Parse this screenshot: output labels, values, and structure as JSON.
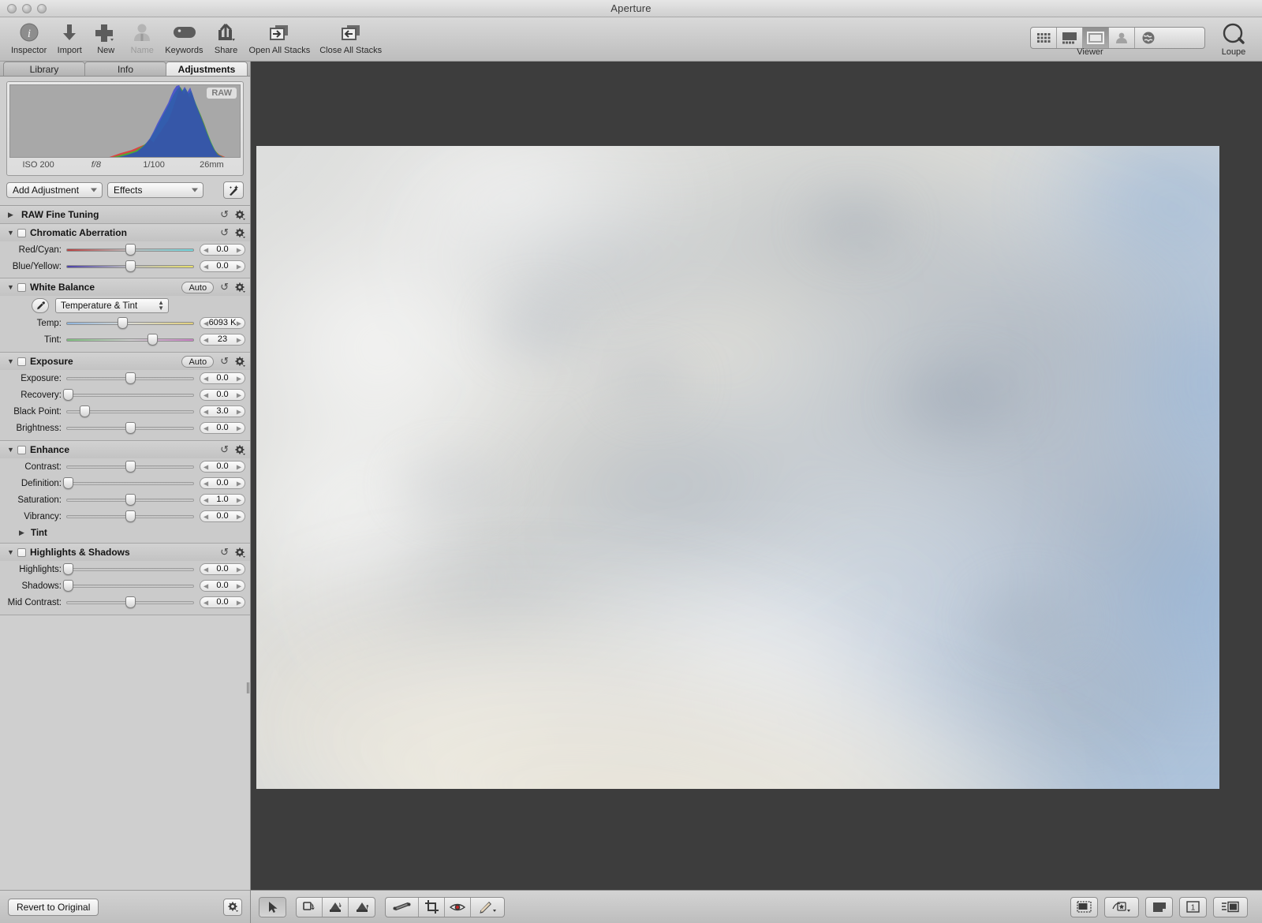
{
  "window": {
    "title": "Aperture"
  },
  "toolbar": {
    "items": [
      {
        "label": "Inspector",
        "icon": "info-circle-icon"
      },
      {
        "label": "Import",
        "icon": "download-arrow-icon"
      },
      {
        "label": "New",
        "icon": "plus-icon"
      },
      {
        "label": "Name",
        "icon": "person-icon",
        "dimmed": true
      },
      {
        "label": "Keywords",
        "icon": "tag-icon"
      },
      {
        "label": "Share",
        "icon": "share-arrow-icon"
      },
      {
        "label": "Open All Stacks",
        "icon": "stack-open-icon"
      },
      {
        "label": "Close All Stacks",
        "icon": "stack-close-icon"
      }
    ],
    "view_modes": [
      {
        "name": "browser-grid",
        "active": false
      },
      {
        "name": "split-view",
        "active": false
      },
      {
        "name": "viewer",
        "active": true
      },
      {
        "name": "faces",
        "active": false
      },
      {
        "name": "places",
        "active": false
      }
    ],
    "viewer_label": "Viewer",
    "loupe_label": "Loupe"
  },
  "inspector": {
    "tabs": [
      {
        "label": "Library",
        "active": false
      },
      {
        "label": "Info",
        "active": false
      },
      {
        "label": "Adjustments",
        "active": true
      }
    ],
    "histogram": {
      "badge": "RAW",
      "exif": [
        "ISO 200",
        "f/8",
        "1/100",
        "26mm"
      ]
    },
    "add_adjustment_label": "Add Adjustment",
    "effects_label": "Effects",
    "wand_icon": "magic-wand-icon",
    "sections": [
      {
        "name": "raw-fine-tuning",
        "title": "RAW Fine Tuning",
        "expanded": false,
        "checkbox": false,
        "auto": false,
        "rows": []
      },
      {
        "name": "chromatic-aberration",
        "title": "Chromatic Aberration",
        "expanded": true,
        "checkbox": true,
        "auto": false,
        "rows": [
          {
            "label": "Red/Cyan:",
            "value": "0.0",
            "pos": 50,
            "track": "rc"
          },
          {
            "label": "Blue/Yellow:",
            "value": "0.0",
            "pos": 50,
            "track": "by"
          }
        ]
      },
      {
        "name": "white-balance",
        "title": "White Balance",
        "expanded": true,
        "checkbox": true,
        "auto": true,
        "auto_label": "Auto",
        "mode_label": "Temperature & Tint",
        "eyedropper_icon": "eyedropper-icon",
        "rows": [
          {
            "label": "Temp:",
            "value": "6093 K",
            "pos": 44,
            "track": "temp"
          },
          {
            "label": "Tint:",
            "value": "23",
            "pos": 67,
            "track": "tint"
          }
        ]
      },
      {
        "name": "exposure",
        "title": "Exposure",
        "expanded": true,
        "checkbox": true,
        "auto": true,
        "auto_label": "Auto",
        "rows": [
          {
            "label": "Exposure:",
            "value": "0.0",
            "pos": 50,
            "track": ""
          },
          {
            "label": "Recovery:",
            "value": "0.0",
            "pos": 1,
            "track": ""
          },
          {
            "label": "Black Point:",
            "value": "3.0",
            "pos": 14,
            "track": ""
          },
          {
            "label": "Brightness:",
            "value": "0.0",
            "pos": 50,
            "track": ""
          }
        ]
      },
      {
        "name": "enhance",
        "title": "Enhance",
        "expanded": true,
        "checkbox": true,
        "auto": false,
        "rows": [
          {
            "label": "Contrast:",
            "value": "0.0",
            "pos": 50,
            "track": ""
          },
          {
            "label": "Definition:",
            "value": "0.0",
            "pos": 1,
            "track": ""
          },
          {
            "label": "Saturation:",
            "value": "1.0",
            "pos": 50,
            "track": ""
          },
          {
            "label": "Vibrancy:",
            "value": "0.0",
            "pos": 50,
            "track": ""
          }
        ],
        "subsection": {
          "title": "Tint",
          "expanded": false
        }
      },
      {
        "name": "highlights-shadows",
        "title": "Highlights & Shadows",
        "expanded": true,
        "checkbox": true,
        "auto": false,
        "rows": [
          {
            "label": "Highlights:",
            "value": "0.0",
            "pos": 1,
            "track": ""
          },
          {
            "label": "Shadows:",
            "value": "0.0",
            "pos": 1,
            "track": ""
          },
          {
            "label": "Mid Contrast:",
            "value": "0.0",
            "pos": 50,
            "track": ""
          }
        ]
      }
    ],
    "revert_label": "Revert to Original",
    "bottom_gear_icon": "gear-icon"
  },
  "viewer_toolbar": {
    "left_tools": [
      {
        "name": "selection-arrow-tool",
        "icon": "arrow-cursor-icon",
        "active": true
      },
      {
        "name": "rotate-left-tool",
        "icon": "rotate-left-icon",
        "active": false
      },
      {
        "name": "lift-tool",
        "icon": "lift-stamp-icon",
        "active": false
      },
      {
        "name": "stamp-tool",
        "icon": "stamp-icon",
        "active": false
      },
      {
        "name": "straighten-tool",
        "icon": "straighten-icon",
        "active": false
      },
      {
        "name": "crop-tool",
        "icon": "crop-icon",
        "active": false
      },
      {
        "name": "red-eye-tool",
        "icon": "red-eye-icon",
        "active": false
      },
      {
        "name": "retouch-brush-tool",
        "icon": "retouch-brush-icon",
        "active": false
      }
    ],
    "right_tools": [
      {
        "name": "show-metadata",
        "icon": "metadata-overlay-icon"
      },
      {
        "name": "rating-overlay",
        "icon": "star-badge-icon"
      },
      {
        "name": "background-color",
        "icon": "page-corner-icon"
      },
      {
        "name": "single-image-view",
        "icon": "one-up-icon",
        "label": "1"
      },
      {
        "name": "show-master",
        "icon": "master-image-icon"
      }
    ]
  },
  "colors": {
    "window_bg": "#cfcfcf",
    "viewer_bg": "#3d3d3d",
    "accent_blue": "#4a6fa8",
    "histogram_red": "#e03b3b",
    "histogram_green": "#2fc02f",
    "histogram_blue": "#2b39d6"
  }
}
